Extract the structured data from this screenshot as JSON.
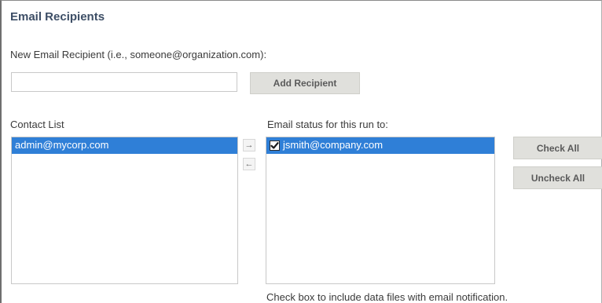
{
  "section": {
    "title": "Email Recipients"
  },
  "new_recipient": {
    "label": "New Email Recipient (i.e., someone@organization.com):",
    "value": "",
    "placeholder": "",
    "add_button": "Add Recipient"
  },
  "contact_list": {
    "label": "Contact List",
    "items": [
      {
        "email": "admin@mycorp.com",
        "selected": true
      }
    ]
  },
  "transfer": {
    "right_arrow": "→",
    "left_arrow": "←"
  },
  "email_status": {
    "label": "Email status for this run to:",
    "items": [
      {
        "email": "jsmith@company.com",
        "checked": true,
        "selected": true
      }
    ],
    "check_all": "Check All",
    "uncheck_all": "Uncheck All"
  },
  "footnote": "Check box to include data files with email notification.",
  "colors": {
    "title": "#3d4e66",
    "selection": "#2f7fd7",
    "button_bg": "#e0e0dc"
  },
  "icons": {
    "move_right": "arrow-right-icon",
    "move_left": "arrow-left-icon",
    "checkbox": "checkbox-checked-icon"
  }
}
